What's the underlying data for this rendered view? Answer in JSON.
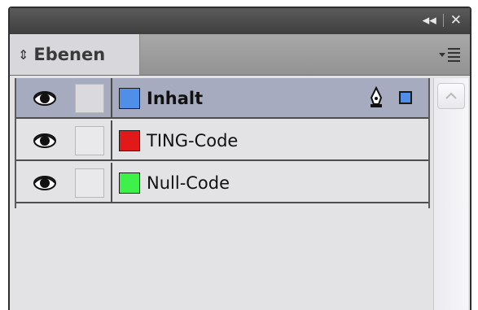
{
  "panel": {
    "title_controls": {
      "collapse": "◂◂",
      "close": "✕"
    },
    "tab_label": "Ebenen",
    "tab_arrows": "⇕"
  },
  "layers": [
    {
      "name": "Inhalt",
      "color": "#4f8fe8",
      "selected": true,
      "visible": true
    },
    {
      "name": "TING-Code",
      "color": "#e11919",
      "selected": false,
      "visible": true
    },
    {
      "name": "Null-Code",
      "color": "#3df04a",
      "selected": false,
      "visible": true
    }
  ],
  "icons": [
    "eye-icon",
    "pen-icon",
    "panel-menu-icon",
    "scroll-up-icon"
  ]
}
